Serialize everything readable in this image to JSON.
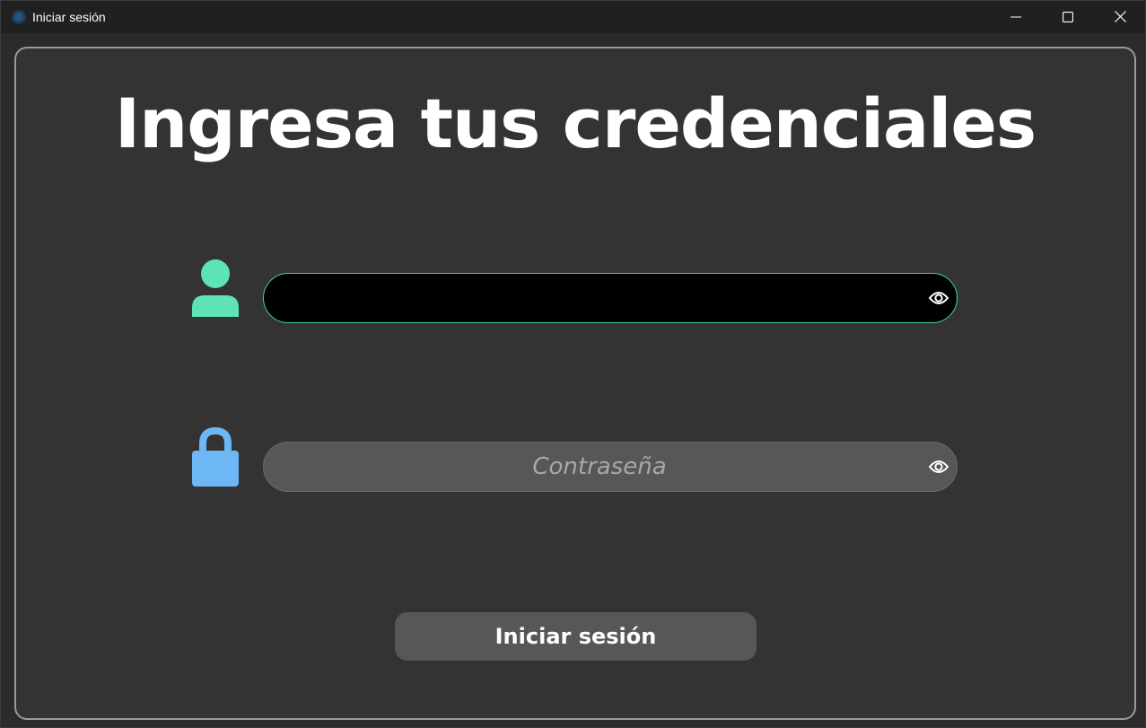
{
  "window": {
    "title": "Iniciar sesión",
    "app_icon": "app-logo-icon",
    "controls": [
      "minimize-icon",
      "maximize-icon",
      "close-icon"
    ]
  },
  "login": {
    "heading": "Ingresa tus credenciales",
    "username": {
      "icon": "user-icon",
      "value": "",
      "placeholder": "",
      "toggle_icon": "eye-icon"
    },
    "password": {
      "icon": "lock-icon",
      "value": "",
      "placeholder": "Contraseña",
      "toggle_icon": "eye-icon"
    },
    "submit_label": "Iniciar sesión"
  },
  "colors": {
    "title_bar": "#202020",
    "panel_background": "#333333",
    "panel_border": "#9a9a9a",
    "user_icon": "#5ee3b8",
    "lock_icon": "#6db7f5",
    "active_field_border": "#3fd6a8",
    "button_background": "#575757"
  }
}
